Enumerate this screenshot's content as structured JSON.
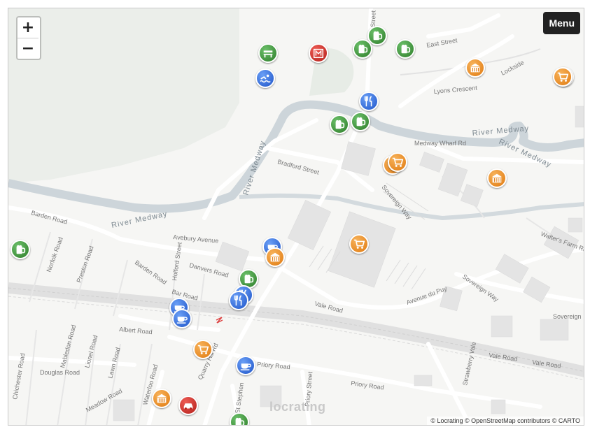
{
  "controls": {
    "zoom_in": "+",
    "zoom_out": "−",
    "menu": "Menu"
  },
  "attribution": "© Locrating © OpenStreetMap contributors © CARTO",
  "watermark": "locrating",
  "street_labels": {
    "east_street": "East Street",
    "lockside": "Lockside",
    "lyons_crescent": "Lyons Crescent",
    "river_medway_1": "River Medway",
    "river_medway_2": "River Medway",
    "river_medway_3": "River Medway",
    "river_medway_4": "River Medway",
    "medway_wharf_rd": "Medway Wharf Rd",
    "bradford_street": "Bradford Street",
    "sovereign_way_1": "Sovereign Way",
    "sovereign_way_2": "Sovereign Way",
    "sovereign_way_3": "Sovereign",
    "barden_road_1": "Barden Road",
    "barden_road_2": "Barden Road",
    "barden_road_3": "Bar  Road",
    "avebury_avenue": "Avebury Avenue",
    "norfolk_road": "Norfolk Road",
    "preston_road": "Preston Road",
    "holford_street": "Holford Street",
    "danvers_road": "Danvers Road",
    "vale_road_1": "Vale Road",
    "vale_road_2": "Vale Road",
    "vale_road_3": "Vale Road",
    "avenue_du_puy": "Avenue du Puy",
    "walters_farm_rd": "Walter's Farm Rd",
    "albert_road": "Albert Road",
    "quarry_hill_rd": "Quarry Hill Rd",
    "priory_road_1": "Priory Road",
    "priory_road_2": "Priory Road",
    "strawberry_vale": "Strawberry Vale",
    "douglas_road": "Douglas Road",
    "mabledon_road": "Mabledon Road",
    "lionel_road": "Lionel Road",
    "lawn_road": "Lawn Road",
    "meadow_road": "Meadow Road",
    "waterloo_road": "Waterloo Road",
    "chichester_road": "Chichester Road",
    "st_stephen": "St Stephen",
    "priory_street": "Priory Street",
    "bank_street": "Bank Street"
  },
  "colors": {
    "green": "#2e7d2a",
    "orange": "#e07a10",
    "blue": "#1f55c9",
    "red": "#b3201a"
  },
  "markers": [
    {
      "type": "pub",
      "color": "green",
      "icon": "beer-mug-icon"
    },
    {
      "type": "pub",
      "color": "green",
      "icon": "beer-mug-icon"
    },
    {
      "type": "pub",
      "color": "green",
      "icon": "beer-mug-icon"
    },
    {
      "type": "supermarket",
      "color": "orange",
      "icon": "shopping-cart-icon"
    },
    {
      "type": "museum",
      "color": "orange",
      "icon": "building-icon"
    },
    {
      "type": "supermarket",
      "color": "orange",
      "icon": "shopping-cart-icon"
    },
    {
      "type": "swimming",
      "color": "blue",
      "icon": "swimming-icon"
    },
    {
      "type": "park",
      "color": "green",
      "icon": "bench-icon"
    },
    {
      "type": "museum",
      "color": "red",
      "icon": "museum-icon"
    },
    {
      "type": "restaurant",
      "color": "blue",
      "icon": "fork-knife-icon"
    },
    {
      "type": "pub",
      "color": "green",
      "icon": "beer-mug-icon"
    },
    {
      "type": "pub",
      "color": "green",
      "icon": "beer-mug-icon"
    },
    {
      "type": "supermarket",
      "color": "orange",
      "icon": "shopping-cart-icon"
    },
    {
      "type": "supermarket",
      "color": "orange",
      "icon": "shopping-cart-icon"
    },
    {
      "type": "museum",
      "color": "orange",
      "icon": "building-icon"
    },
    {
      "type": "pub",
      "color": "green",
      "icon": "beer-mug-icon"
    },
    {
      "type": "cafe",
      "color": "blue",
      "icon": "cup-icon"
    },
    {
      "type": "museum",
      "color": "orange",
      "icon": "building-icon"
    },
    {
      "type": "supermarket",
      "color": "orange",
      "icon": "shopping-cart-icon"
    },
    {
      "type": "pub",
      "color": "green",
      "icon": "beer-mug-icon"
    },
    {
      "type": "restaurant",
      "color": "blue",
      "icon": "fork-knife-icon"
    },
    {
      "type": "restaurant",
      "color": "blue",
      "icon": "fork-knife-icon"
    },
    {
      "type": "cafe",
      "color": "blue",
      "icon": "cup-icon"
    },
    {
      "type": "cafe",
      "color": "blue",
      "icon": "cup-icon"
    },
    {
      "type": "supermarket",
      "color": "orange",
      "icon": "shopping-cart-icon"
    },
    {
      "type": "cafe",
      "color": "blue",
      "icon": "cup-icon"
    },
    {
      "type": "museum",
      "color": "orange",
      "icon": "building-icon"
    },
    {
      "type": "car",
      "color": "red",
      "icon": "car-icon"
    },
    {
      "type": "pub",
      "color": "green",
      "icon": "beer-mug-icon"
    }
  ]
}
